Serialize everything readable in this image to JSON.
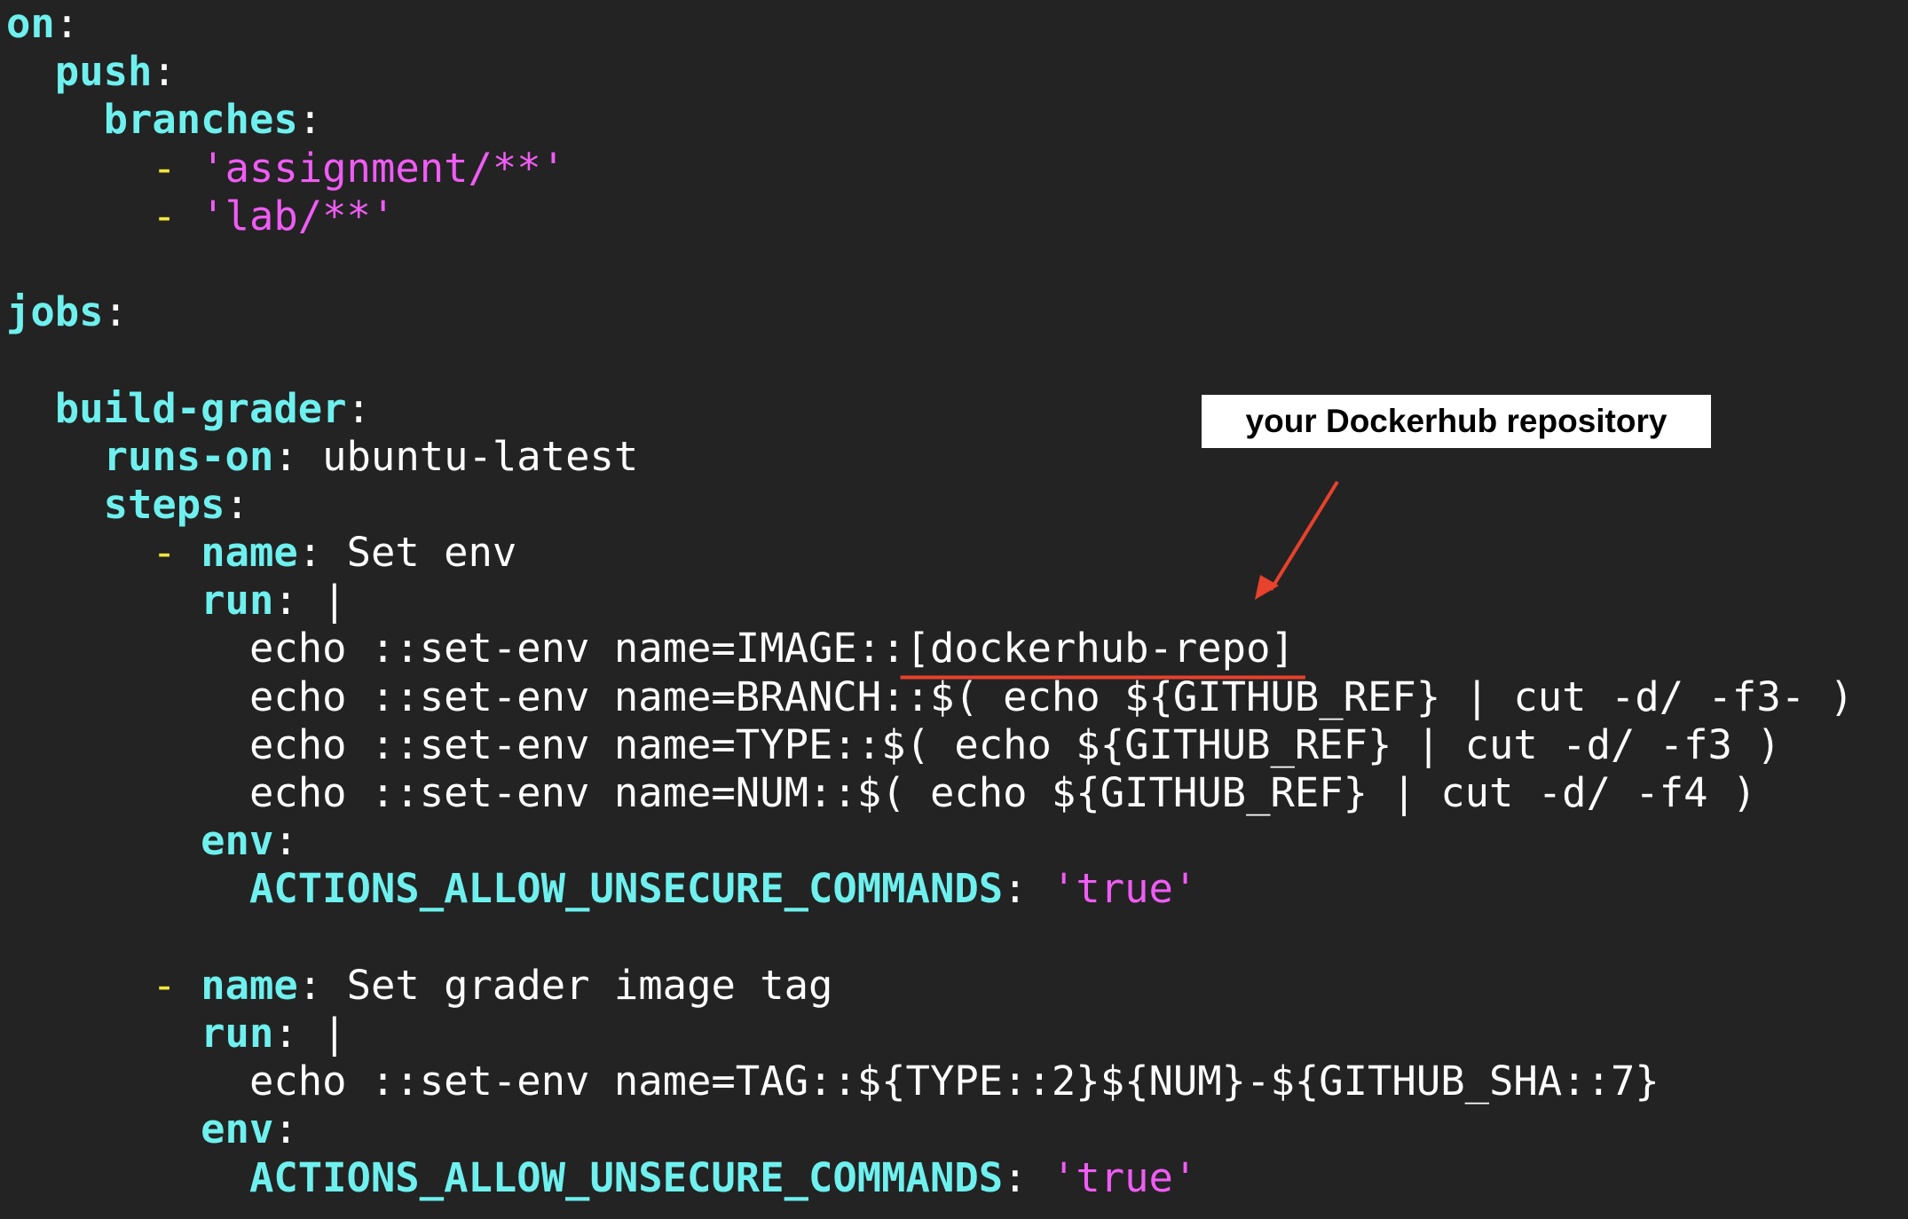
{
  "colors": {
    "background": "#232323",
    "key": "#6ef0ee",
    "string": "#f05cf5",
    "dash": "#f2e63b",
    "text": "#ffffff",
    "annotation": "#e8412c"
  },
  "code": {
    "on_key": "on",
    "push_key": "push",
    "branches_key": "branches",
    "branch_1": "'assignment/**'",
    "branch_2": "'lab/**'",
    "jobs_key": "jobs",
    "job_name": "build-grader",
    "runs_on_key": "runs-on",
    "runs_on_value": "ubuntu-latest",
    "steps_key": "steps",
    "name_key": "name",
    "step1_name": "Set env",
    "run_key": "run",
    "pipe": "|",
    "echo_image": "echo ::set-env name=IMAGE::",
    "image_placeholder": "[dockerhub-repo]",
    "echo_branch": "echo ::set-env name=BRANCH::$( echo ${GITHUB_REF} | cut -d/ -f3- )",
    "echo_type": "echo ::set-env name=TYPE::$( echo ${GITHUB_REF} | cut -d/ -f3 )",
    "echo_num": "echo ::set-env name=NUM::$( echo ${GITHUB_REF} | cut -d/ -f4 )",
    "env_key": "env",
    "allow_key": "ACTIONS_ALLOW_UNSECURE_COMMANDS",
    "true_value": "'true'",
    "step2_name": "Set grader image tag",
    "echo_tag": "echo ::set-env name=TAG::${TYPE::2}${NUM}-${GITHUB_SHA::7}"
  },
  "annotation": {
    "label": "your Dockerhub repository"
  }
}
